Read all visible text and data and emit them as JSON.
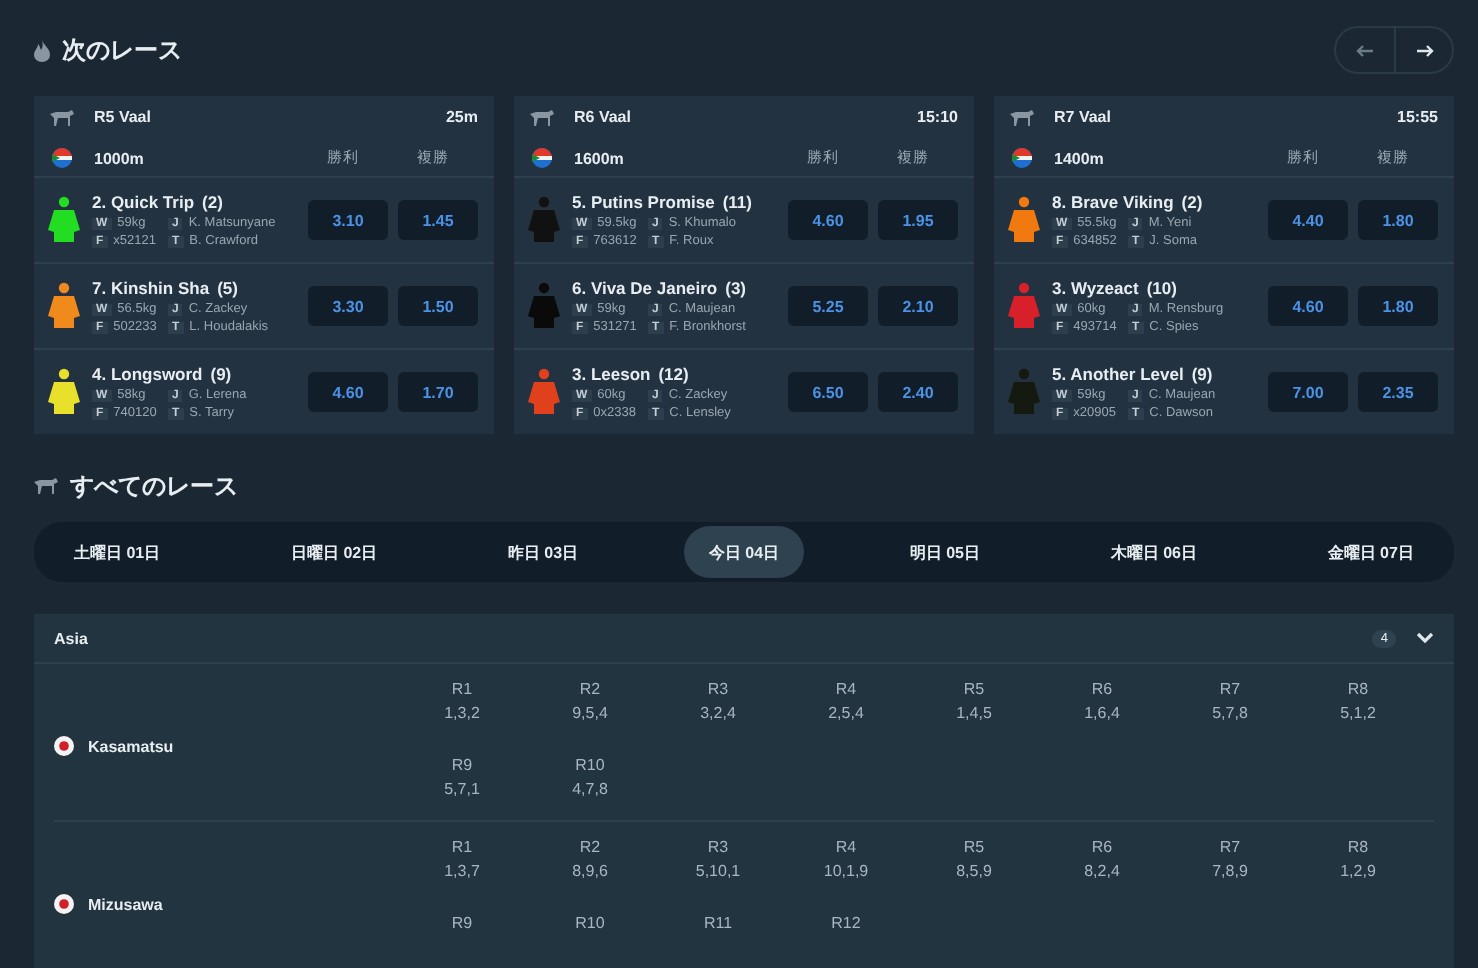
{
  "next_races": {
    "title": "次のレース",
    "cards": [
      {
        "race": "R5 Vaal",
        "time": "25m",
        "distance": "1000m",
        "columns": [
          "勝利",
          "複勝"
        ],
        "runners": [
          {
            "name": "2. Quick Trip",
            "draw": "(2)",
            "color": "#22dd22",
            "stats": [
              {
                "label": "W",
                "value": "59kg"
              },
              {
                "label": "J",
                "value": "K. Matsunyane"
              },
              {
                "label": "F",
                "value": "x52121"
              },
              {
                "label": "T",
                "value": "B. Crawford"
              }
            ],
            "odds": [
              "3.10",
              "1.45"
            ]
          },
          {
            "name": "7. Kinshin Sha",
            "draw": "(5)",
            "color": "#f08a1c",
            "stats": [
              {
                "label": "W",
                "value": "56.5kg"
              },
              {
                "label": "J",
                "value": "C. Zackey"
              },
              {
                "label": "F",
                "value": "502233"
              },
              {
                "label": "T",
                "value": "L. Houdalakis"
              }
            ],
            "odds": [
              "3.30",
              "1.50"
            ]
          },
          {
            "name": "4. Longsword",
            "draw": "(9)",
            "color": "#e8e02a",
            "stats": [
              {
                "label": "W",
                "value": "58kg"
              },
              {
                "label": "J",
                "value": "G. Lerena"
              },
              {
                "label": "F",
                "value": "740120"
              },
              {
                "label": "T",
                "value": "S. Tarry"
              }
            ],
            "odds": [
              "4.60",
              "1.70"
            ]
          }
        ]
      },
      {
        "race": "R6 Vaal",
        "time": "15:10",
        "distance": "1600m",
        "columns": [
          "勝利",
          "複勝"
        ],
        "runners": [
          {
            "name": "5. Putins Promise",
            "draw": "(11)",
            "color": "#111111",
            "stats": [
              {
                "label": "W",
                "value": "59.5kg"
              },
              {
                "label": "J",
                "value": "S. Khumalo"
              },
              {
                "label": "F",
                "value": "763612"
              },
              {
                "label": "T",
                "value": "F. Roux"
              }
            ],
            "odds": [
              "4.60",
              "1.95"
            ]
          },
          {
            "name": "6. Viva De Janeiro",
            "draw": "(3)",
            "color": "#0a0a0a",
            "stats": [
              {
                "label": "W",
                "value": "59kg"
              },
              {
                "label": "J",
                "value": "C. Maujean"
              },
              {
                "label": "F",
                "value": "531271"
              },
              {
                "label": "T",
                "value": "F. Bronkhorst"
              }
            ],
            "odds": [
              "5.25",
              "2.10"
            ]
          },
          {
            "name": "3. Leeson",
            "draw": "(12)",
            "color": "#e0401c",
            "stats": [
              {
                "label": "W",
                "value": "60kg"
              },
              {
                "label": "J",
                "value": "C. Zackey"
              },
              {
                "label": "F",
                "value": "0x2338"
              },
              {
                "label": "T",
                "value": "C. Lensley"
              }
            ],
            "odds": [
              "6.50",
              "2.40"
            ]
          }
        ]
      },
      {
        "race": "R7 Vaal",
        "time": "15:55",
        "distance": "1400m",
        "columns": [
          "勝利",
          "複勝"
        ],
        "runners": [
          {
            "name": "8. Brave Viking",
            "draw": "(2)",
            "color": "#f07a10",
            "stats": [
              {
                "label": "W",
                "value": "55.5kg"
              },
              {
                "label": "J",
                "value": "M. Yeni"
              },
              {
                "label": "F",
                "value": "634852"
              },
              {
                "label": "T",
                "value": "J. Soma"
              }
            ],
            "odds": [
              "4.40",
              "1.80"
            ]
          },
          {
            "name": "3. Wyzeact",
            "draw": "(10)",
            "color": "#d8202a",
            "stats": [
              {
                "label": "W",
                "value": "60kg"
              },
              {
                "label": "J",
                "value": "M. Rensburg"
              },
              {
                "label": "F",
                "value": "493714"
              },
              {
                "label": "T",
                "value": "C. Spies"
              }
            ],
            "odds": [
              "4.60",
              "1.80"
            ]
          },
          {
            "name": "5. Another Level",
            "draw": "(9)",
            "color": "#151a10",
            "stats": [
              {
                "label": "W",
                "value": "59kg"
              },
              {
                "label": "J",
                "value": "C. Maujean"
              },
              {
                "label": "F",
                "value": "x20905"
              },
              {
                "label": "T",
                "value": "C. Dawson"
              }
            ],
            "odds": [
              "7.00",
              "2.35"
            ]
          }
        ]
      }
    ]
  },
  "all_races": {
    "title": "すべてのレース",
    "dates": [
      {
        "label": "土曜日 01日",
        "selected": false
      },
      {
        "label": "日曜日 02日",
        "selected": false
      },
      {
        "label": "昨日 03日",
        "selected": false
      },
      {
        "label": "今日 04日",
        "selected": true
      },
      {
        "label": "明日 05日",
        "selected": false
      },
      {
        "label": "木曜日 06日",
        "selected": false
      },
      {
        "label": "金曜日 07日",
        "selected": false
      }
    ],
    "region": {
      "name": "Asia",
      "count": "4",
      "expanded": true,
      "tracks": [
        {
          "name": "Kasamatsu",
          "results": [
            {
              "race": "R1",
              "result": "1,3,2"
            },
            {
              "race": "R2",
              "result": "9,5,4"
            },
            {
              "race": "R3",
              "result": "3,2,4"
            },
            {
              "race": "R4",
              "result": "2,5,4"
            },
            {
              "race": "R5",
              "result": "1,4,5"
            },
            {
              "race": "R6",
              "result": "1,6,4"
            },
            {
              "race": "R7",
              "result": "5,7,8"
            },
            {
              "race": "R8",
              "result": "5,1,2"
            },
            {
              "race": "R9",
              "result": "5,7,1"
            },
            {
              "race": "R10",
              "result": "4,7,8"
            }
          ]
        },
        {
          "name": "Mizusawa",
          "results": [
            {
              "race": "R1",
              "result": "1,3,7"
            },
            {
              "race": "R2",
              "result": "8,9,6"
            },
            {
              "race": "R3",
              "result": "5,10,1"
            },
            {
              "race": "R4",
              "result": "10,1,9"
            },
            {
              "race": "R5",
              "result": "8,5,9"
            },
            {
              "race": "R6",
              "result": "8,2,4"
            },
            {
              "race": "R7",
              "result": "7,8,9"
            },
            {
              "race": "R8",
              "result": "1,2,9"
            },
            {
              "race": "R9"
            },
            {
              "race": "R10"
            },
            {
              "race": "R11"
            },
            {
              "race": "R12"
            }
          ]
        }
      ]
    }
  }
}
